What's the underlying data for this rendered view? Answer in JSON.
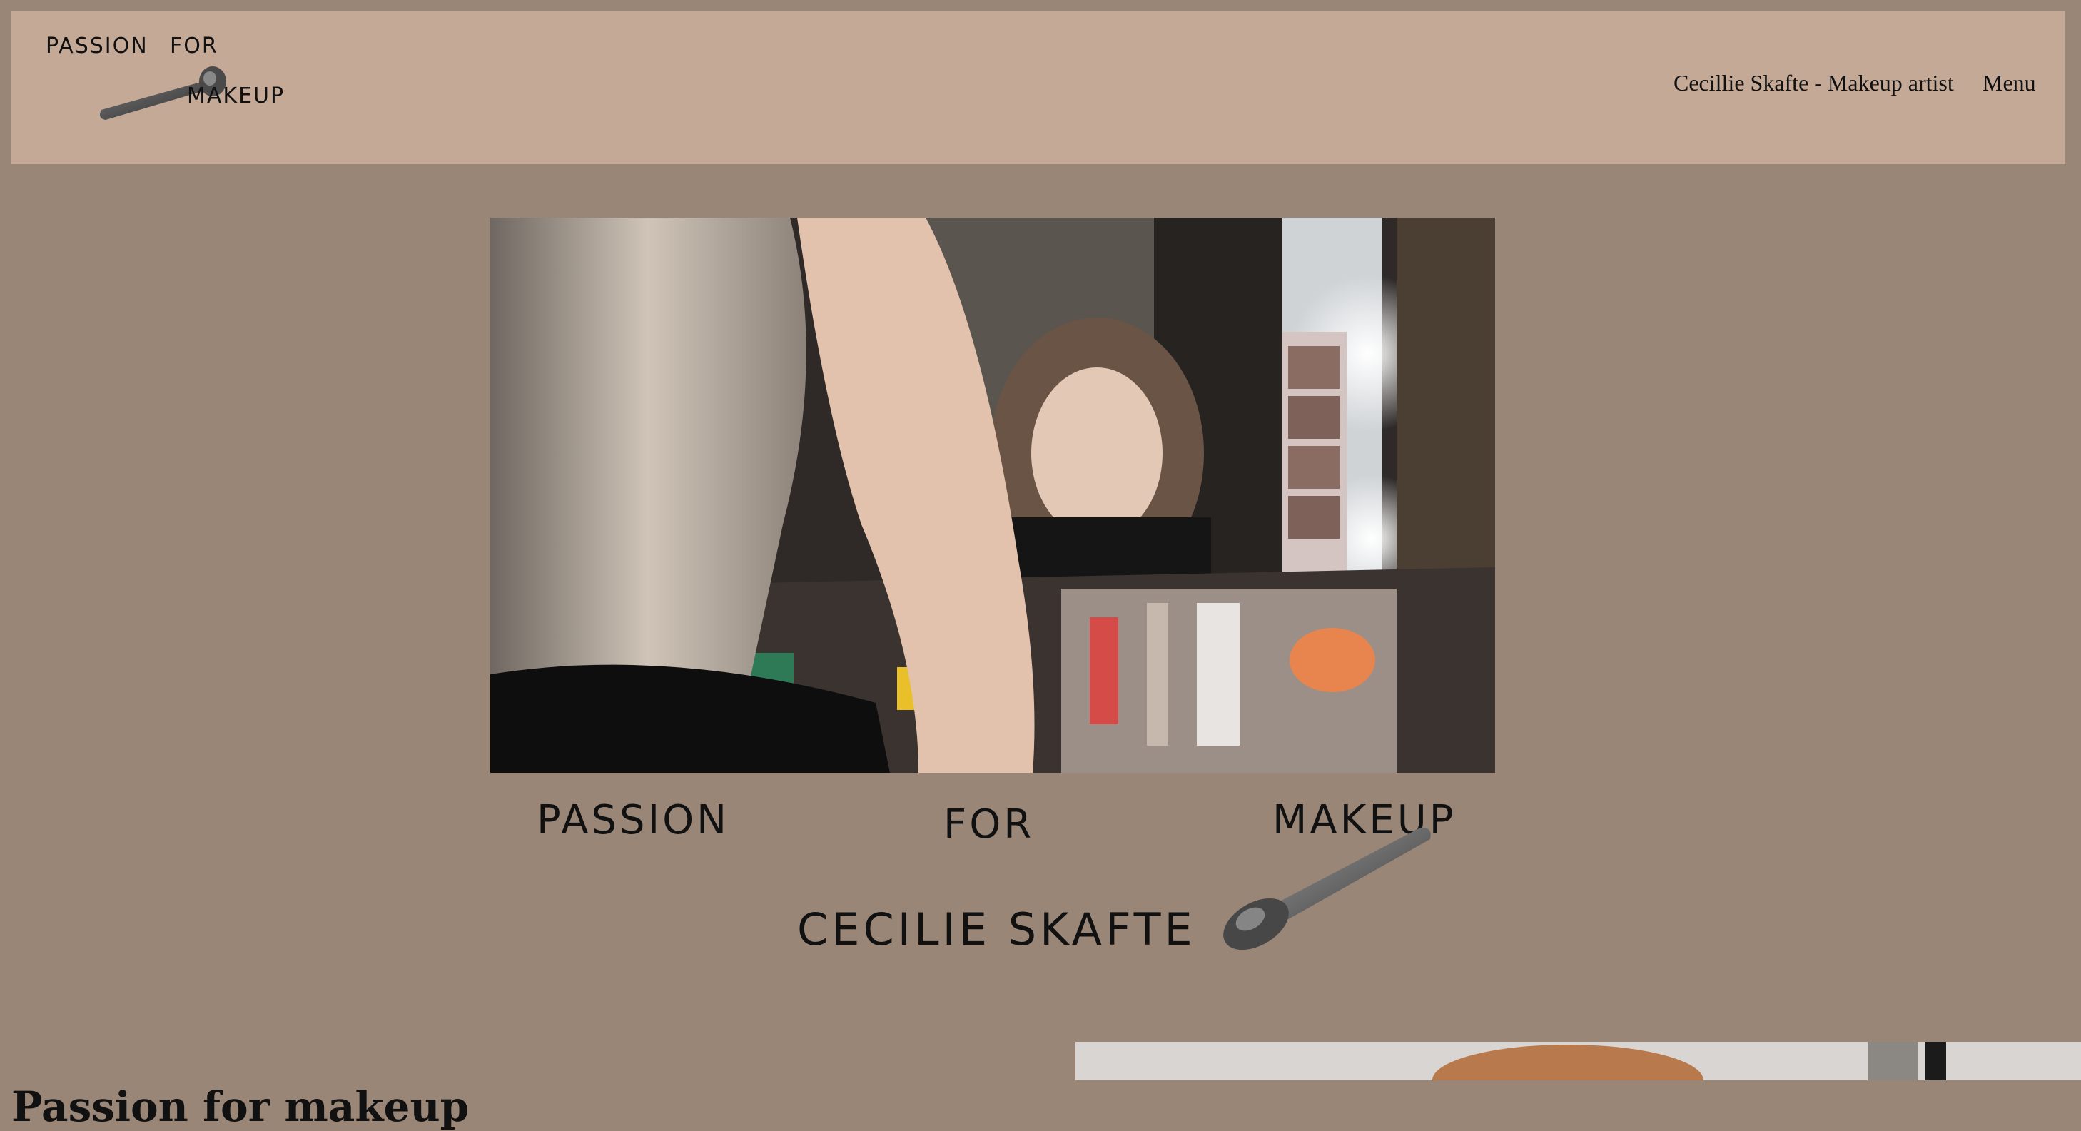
{
  "header": {
    "logo": {
      "word1": "PASSION",
      "word2": "FOR",
      "word3": "MAKEUP"
    },
    "nav": {
      "artist_link": "Cecillie Skafte - Makeup artist",
      "menu_label": "Menu"
    }
  },
  "hero": {
    "image_icon": "makeup-mirror-photo"
  },
  "brand_block": {
    "word1": "PASSION",
    "word2": "FOR",
    "word3": "MAKEUP",
    "name": "CECILIE SKAFTE"
  },
  "section": {
    "heading": "Passion for makeup"
  },
  "colors": {
    "page_bg": "#9a8677",
    "header_bg": "#c4a996",
    "text": "#111111"
  }
}
